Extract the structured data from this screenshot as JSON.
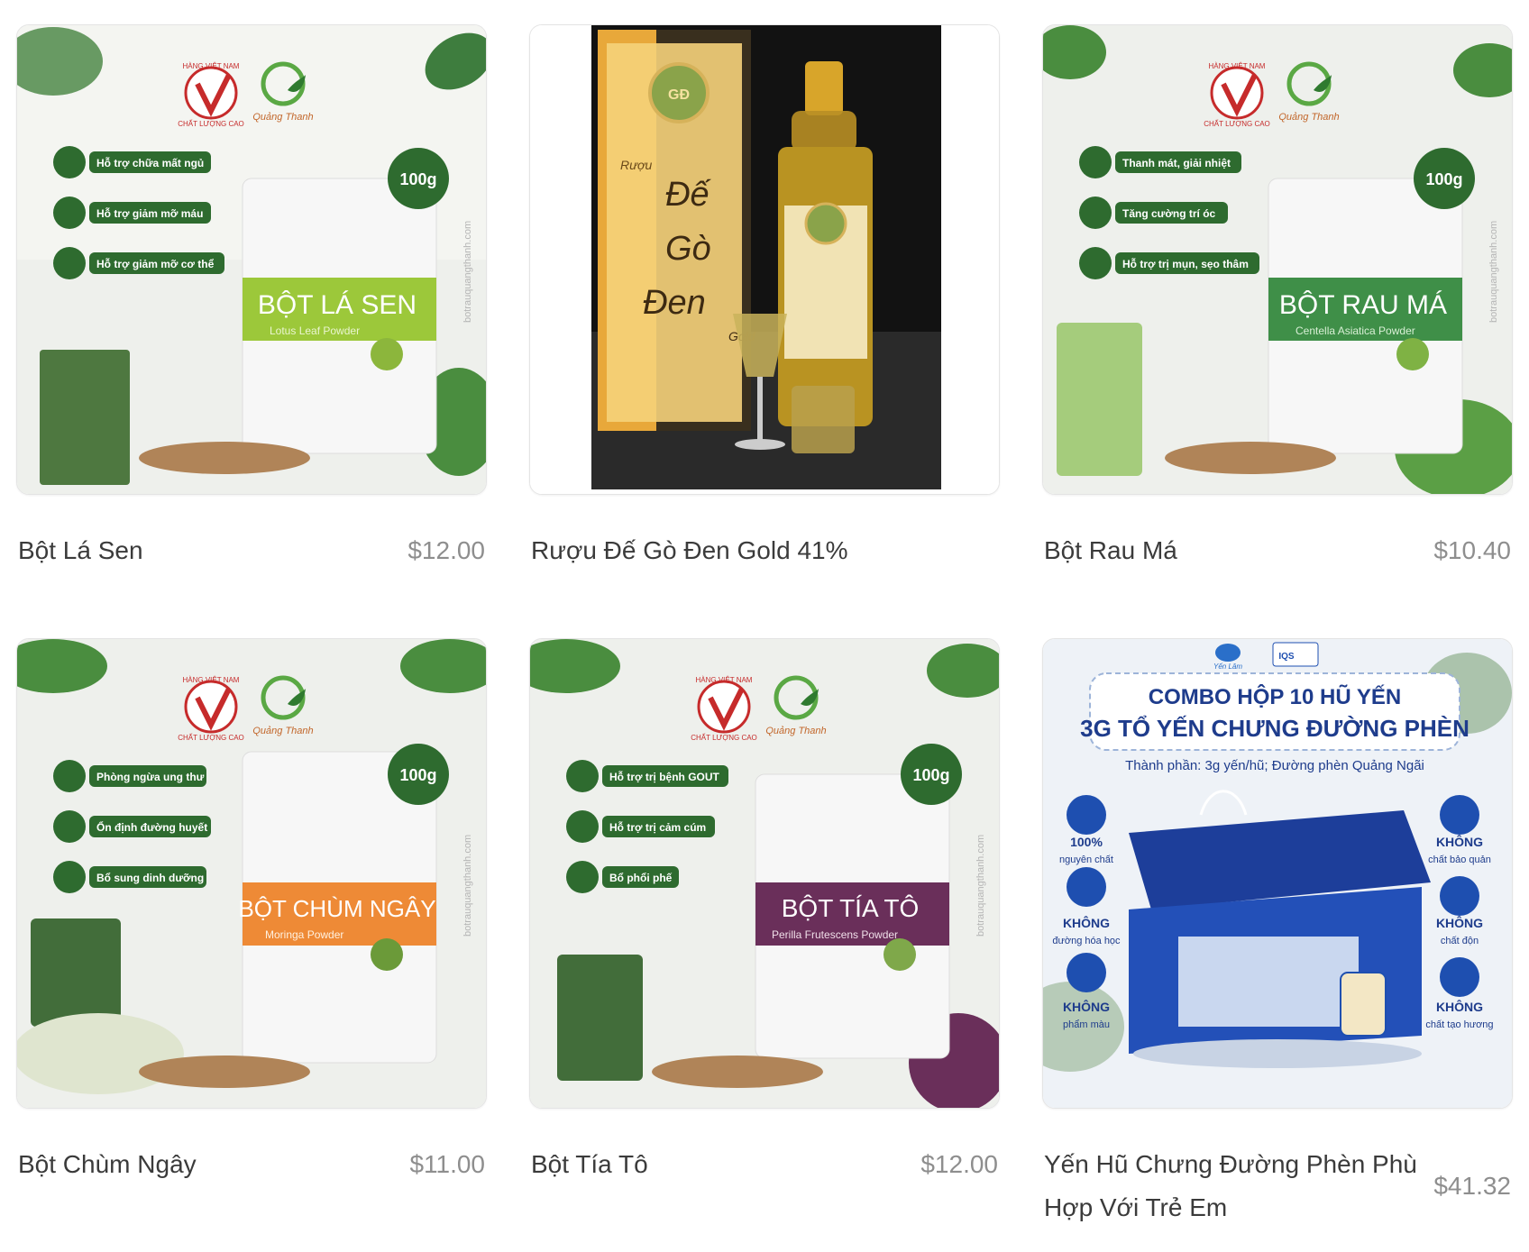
{
  "products": [
    {
      "name": "Bột Lá Sen",
      "price": "$12.00",
      "image": {
        "brand": "Quảng Thanh",
        "badge_lines": [
          "HÀNG VIỆT NAM",
          "CHẤT LƯỢNG CAO"
        ],
        "weight": "100g",
        "benefits": [
          "Hỗ trợ chữa mất ngủ",
          "Hỗ trợ giảm mỡ máu",
          "Hỗ trợ giảm mỡ cơ thể"
        ],
        "pack_title": "BỘT LÁ SEN",
        "pack_subtitle": "Lotus Leaf Powder",
        "side_url": "botrauquangthanh.com",
        "band_color": "#9cc83a"
      }
    },
    {
      "name": "Rượu Đế Gò Đen Gold 41%",
      "price": "",
      "image": {
        "box_label": "Rượu",
        "box_title": [
          "Đế",
          "Gò",
          "Đen"
        ],
        "box_gold": "Gold",
        "seal_text": "GĐ"
      }
    },
    {
      "name": "Bột Rau Má",
      "price": "$10.40",
      "image": {
        "brand": "Quảng Thanh",
        "badge_lines": [
          "HÀNG VIỆT NAM",
          "CHẤT LƯỢNG CAO"
        ],
        "weight": "100g",
        "benefits": [
          "Thanh mát, giải nhiệt",
          "Tăng cường trí óc",
          "Hỗ trợ trị mụn, sẹo thâm"
        ],
        "pack_title": "BỘT RAU MÁ",
        "pack_subtitle": "Centella Asiatica Powder",
        "side_url": "botrauquangthanh.com",
        "band_color": "#3f8f48"
      }
    },
    {
      "name": "Bột Chùm Ngây",
      "price": "$11.00",
      "image": {
        "brand": "Quảng Thanh",
        "badge_lines": [
          "HÀNG VIỆT NAM",
          "CHẤT LƯỢNG CAO"
        ],
        "weight": "100g",
        "benefits": [
          "Phòng ngừa ung thư",
          "Ổn định đường huyết",
          "Bổ sung dinh dưỡng"
        ],
        "pack_title": "BỘT CHÙM NGÂY",
        "pack_subtitle": "Moringa Powder",
        "side_url": "botrauquangthanh.com",
        "band_color": "#ee8a36"
      }
    },
    {
      "name": "Bột Tía Tô",
      "price": "$12.00",
      "image": {
        "brand": "Quảng Thanh",
        "badge_lines": [
          "HÀNG VIỆT NAM",
          "CHẤT LƯỢNG CAO"
        ],
        "weight": "100g",
        "benefits": [
          "Hỗ trợ trị bệnh GOUT",
          "Hỗ trợ trị cảm cúm",
          "Bổ phổi phế"
        ],
        "pack_title": "BỘT TÍA TÔ",
        "pack_subtitle": "Perilla Frutescens Powder",
        "side_url": "botrauquangthanh.com",
        "band_color": "#6a2f5a"
      }
    },
    {
      "name": "Yến Hũ Chưng Đường Phèn Phù Hợp Với Trẻ Em",
      "price": "$41.32",
      "image": {
        "headline_1": "COMBO HỘP 10 HŨ YẾN",
        "headline_2": "3G TỔ YẾN CHƯNG ĐƯỜNG PHÈN",
        "ingredients": "Thành phần: 3g yến/hũ; Đường phèn Quảng Ngãi",
        "left_features": [
          {
            "title": "100%",
            "sub": "nguyên chất"
          },
          {
            "title": "KHÔNG",
            "sub": "đường hóa học"
          },
          {
            "title": "KHÔNG",
            "sub": "phẩm màu"
          }
        ],
        "right_features": [
          {
            "title": "KHÔNG",
            "sub": "chất bảo quản"
          },
          {
            "title": "KHÔNG",
            "sub": "chất độn"
          },
          {
            "title": "KHÔNG",
            "sub": "chất tạo hương"
          }
        ],
        "cert": "IQS",
        "brand": "Yến Lâm"
      }
    }
  ],
  "colors": {
    "herb_bg": "#eef0ec",
    "green_dark": "#2e6b2f",
    "blue_brand": "#1e4fb0",
    "price_gray": "#8e8e8e"
  }
}
